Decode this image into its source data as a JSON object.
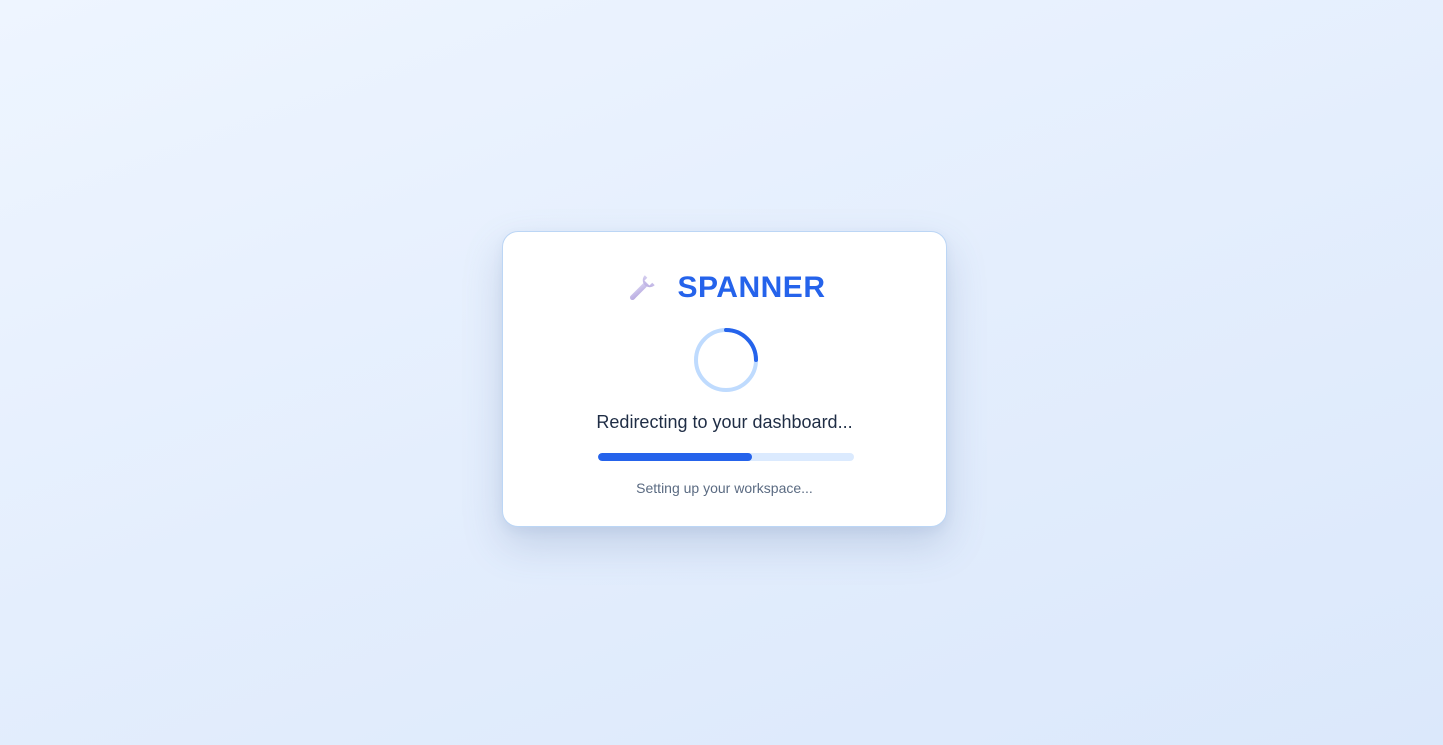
{
  "brand": {
    "name": "SPANNER",
    "icon": "wrench-icon",
    "color": "#2563eb"
  },
  "loader": {
    "icon": "loading-spinner",
    "status": "Redirecting to your dashboard...",
    "progress_percent": 60,
    "detail": "Setting up your workspace..."
  },
  "colors": {
    "accent": "#2563eb",
    "track": "#dbeafe",
    "spinner_ring": "#bfdbfe",
    "card_border": "#bcd6f5"
  }
}
